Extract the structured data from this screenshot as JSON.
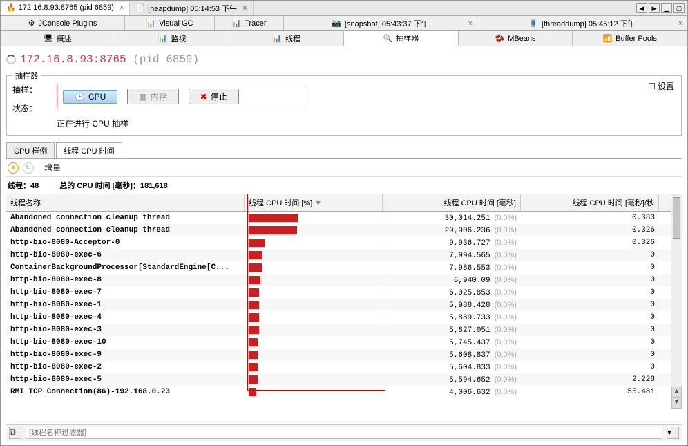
{
  "top_tabs": {
    "t1": "172.16.8.93:8765 (pid 6859)",
    "t2": "[heapdump] 05:14:53 下午"
  },
  "win": {
    "left": "◀",
    "right": "▶",
    "min": "▁",
    "max": "▢"
  },
  "sec_tabs": {
    "s1": "JConsole Plugins",
    "s2": "Visual GC",
    "s3": "Tracer",
    "s4": "[snapshot] 05:43:37 下午",
    "s5": "[threaddump] 05:45:12 下午"
  },
  "ter_tabs": {
    "t1": "概述",
    "t2": "监视",
    "t3": "线程",
    "t4": "抽样器",
    "t5": "MBeans",
    "t6": "Buffer Pools"
  },
  "title": {
    "host": "172.16.8.93:8765",
    "pid": "(pid 6859)"
  },
  "sampler": {
    "legend": "抽样器",
    "settings": "设置",
    "sample_label": "抽样：",
    "btn_cpu": "CPU",
    "btn_mem": "内存",
    "btn_stop": "停止",
    "status_label": "状态：",
    "status_value": "正在进行 CPU 抽样"
  },
  "inner_tabs": {
    "a": "CPU 样例",
    "b": "线程 CPU 时间"
  },
  "toolbar2": {
    "delta": "增量"
  },
  "summary": {
    "threads_lbl": "线程：",
    "threads_val": "48",
    "total_lbl": "总的 CPU 时间 [毫秒]：",
    "total_val": "181,618"
  },
  "columns": {
    "c1": "线程名称",
    "c2": "线程 CPU 时间 [%]",
    "c3": "线程 CPU 时间 [毫秒]",
    "c4": "线程 CPU 时间 [毫秒]/秒"
  },
  "rows": [
    {
      "name": "Abandoned connection cleanup thread",
      "bar": 38,
      "ms": "30,014.251",
      "pct": "(0.0%)",
      "rate": "0.383"
    },
    {
      "name": "Abandoned connection cleanup thread",
      "bar": 37,
      "ms": "29,906.236",
      "pct": "(0.0%)",
      "rate": "0.326"
    },
    {
      "name": "http-bio-8080-Acceptor-0",
      "bar": 13,
      "ms": "9,936.727",
      "pct": "(0.0%)",
      "rate": "0.326"
    },
    {
      "name": "http-bio-8080-exec-6",
      "bar": 10,
      "ms": "7,994.565",
      "pct": "(0.0%)",
      "rate": "0"
    },
    {
      "name": "ContainerBackgroundProcessor[StandardEngine[C...",
      "bar": 10,
      "ms": "7,986.553",
      "pct": "(0.0%)",
      "rate": "0"
    },
    {
      "name": "http-bio-8080-exec-8",
      "bar": 9,
      "ms": "6,940.09",
      "pct": "(0.0%)",
      "rate": "0"
    },
    {
      "name": "http-bio-8080-exec-7",
      "bar": 8,
      "ms": "6,025.853",
      "pct": "(0.0%)",
      "rate": "0"
    },
    {
      "name": "http-bio-8080-exec-1",
      "bar": 8,
      "ms": "5,988.428",
      "pct": "(0.0%)",
      "rate": "0"
    },
    {
      "name": "http-bio-8080-exec-4",
      "bar": 8,
      "ms": "5,889.733",
      "pct": "(0.0%)",
      "rate": "0"
    },
    {
      "name": "http-bio-8080-exec-3",
      "bar": 8,
      "ms": "5,827.051",
      "pct": "(0.0%)",
      "rate": "0"
    },
    {
      "name": "http-bio-8080-exec-10",
      "bar": 7,
      "ms": "5,745.437",
      "pct": "(0.0%)",
      "rate": "0"
    },
    {
      "name": "http-bio-8080-exec-9",
      "bar": 7,
      "ms": "5,608.837",
      "pct": "(0.0%)",
      "rate": "0"
    },
    {
      "name": "http-bio-8080-exec-2",
      "bar": 7,
      "ms": "5,604.833",
      "pct": "(0.0%)",
      "rate": "0"
    },
    {
      "name": "http-bio-8080-exec-5",
      "bar": 7,
      "ms": "5,594.652",
      "pct": "(0.0%)",
      "rate": "2.228"
    },
    {
      "name": "RMI TCP Connection(86)-192.168.0.23",
      "bar": 6,
      "ms": "4,006.632",
      "pct": "(0.0%)",
      "rate": "55.481"
    }
  ],
  "filter": {
    "placeholder": "[线程名称过滤器]"
  },
  "icons": {
    "jmx": "🔥",
    "doc": "📄",
    "gear": "⚙",
    "chart": "📊",
    "clock": "🕒",
    "stop": "✖",
    "beans": "🫘",
    "buf": "📶",
    "snap": "📷",
    "thread": "🧵",
    "check": "☐",
    "refresh": "↻"
  }
}
